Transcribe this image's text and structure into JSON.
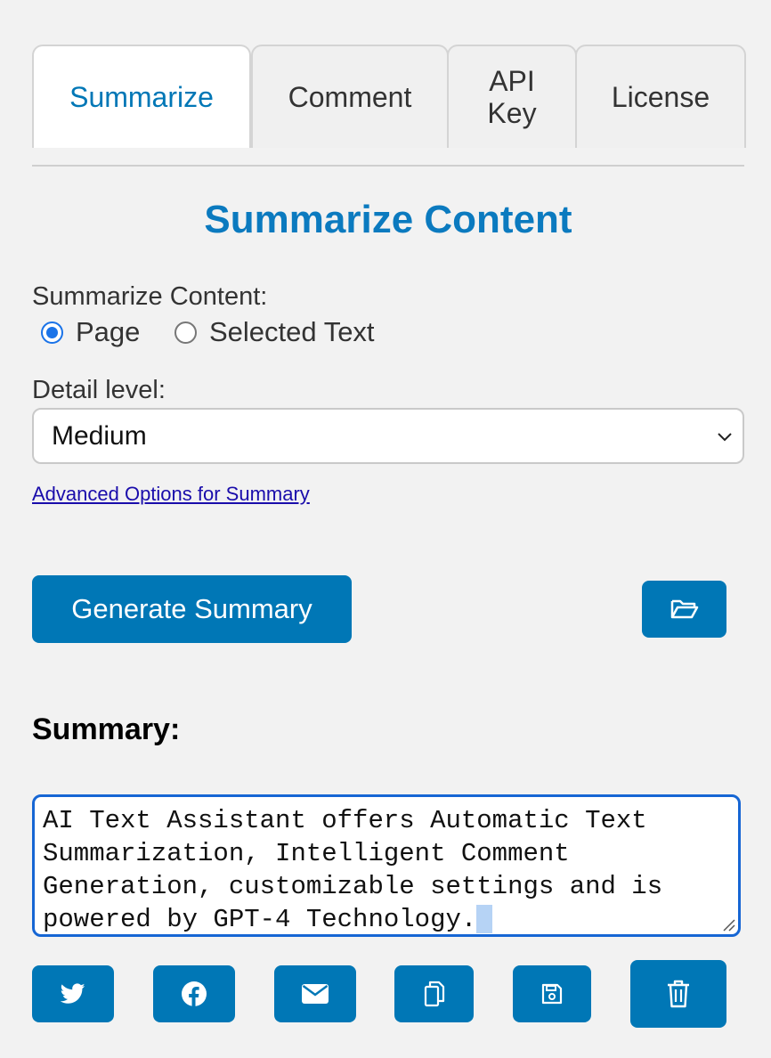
{
  "tabs": [
    {
      "label": "Summarize",
      "active": true
    },
    {
      "label": "Comment",
      "active": false
    },
    {
      "label": "API Key",
      "active": false
    },
    {
      "label": "License",
      "active": false
    }
  ],
  "title": "Summarize Content",
  "content_label": "Summarize Content:",
  "content_options": [
    {
      "label": "Page",
      "checked": true
    },
    {
      "label": "Selected Text",
      "checked": false
    }
  ],
  "detail_label": "Detail level:",
  "detail_selected": "Medium",
  "advanced_link": "Advanced Options for Summary",
  "generate_button": "Generate Summary",
  "summary_heading": "Summary:",
  "summary_text": "AI Text Assistant offers Automatic Text Summarization, Intelligent Comment Generation, customizable settings and is powered by GPT-4 Technology.",
  "icons": {
    "open": "folder-open-icon",
    "share": [
      "twitter-icon",
      "facebook-icon",
      "envelope-icon",
      "copy-icon",
      "save-icon",
      "trash-icon"
    ]
  },
  "colors": {
    "accent": "#0077b6",
    "title": "#0b7abf",
    "link": "#1a0dab",
    "focus": "#1666d4",
    "background": "#f2f2f2"
  }
}
